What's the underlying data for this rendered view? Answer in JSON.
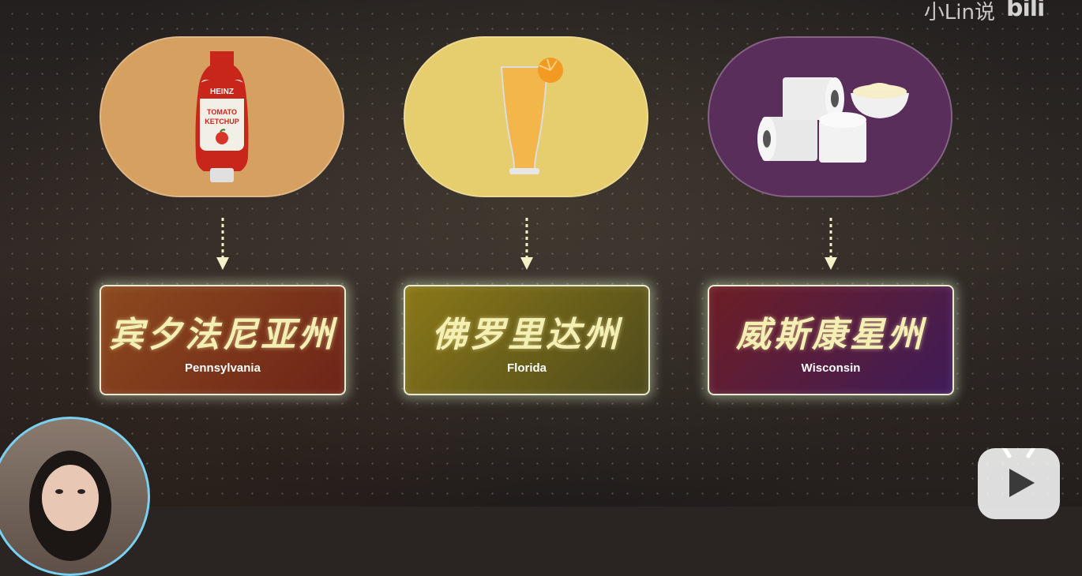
{
  "watermark": {
    "author": "小Lin说",
    "site": "bilibili"
  },
  "items": [
    {
      "product": "ketchup",
      "image_label": "HEINZ TOMATO KETCHUP",
      "state_cn": "宾夕法尼亚州",
      "state_en": "Pennsylvania",
      "pill_color": "#d6a060",
      "box_gradient": [
        "#8c4a1e",
        "#6e2418"
      ]
    },
    {
      "product": "orange juice",
      "state_cn": "佛罗里达州",
      "state_en": "Florida",
      "pill_color": "#e6cd6e",
      "box_gradient": [
        "#8a7818",
        "#4e4a1c"
      ]
    },
    {
      "product": "toilet paper and cream",
      "state_cn": "威斯康星州",
      "state_en": "Wisconsin",
      "pill_color": "#5a2e5a",
      "box_gradient": [
        "#6e1e24",
        "#3e1c58"
      ]
    }
  ],
  "colors": {
    "box_border": "#e9ead0",
    "label_text": "#f4f0b4",
    "avatar_ring": "#7ad0f0"
  }
}
